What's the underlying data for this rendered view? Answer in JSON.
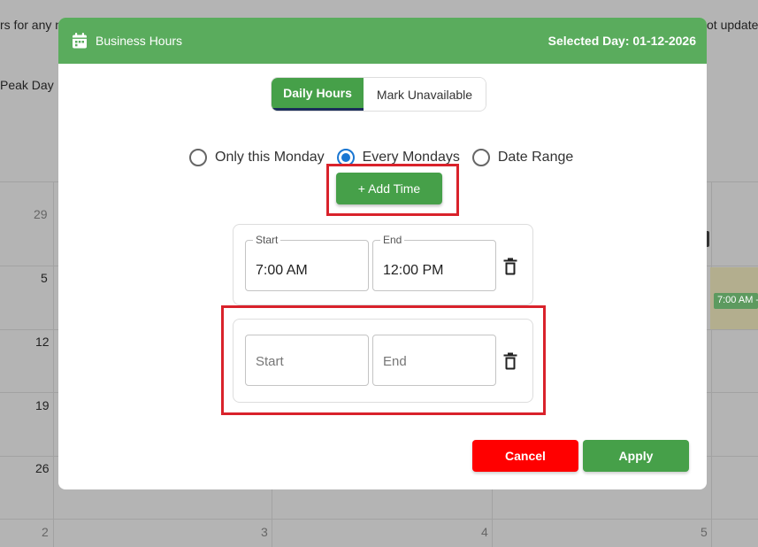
{
  "background": {
    "top_left_text": "rs for any n",
    "top_right_text": "ot update",
    "peak_day_label": "Peak Day",
    "week_numbers": [
      "29",
      "5",
      "12",
      "19",
      "26",
      "2"
    ],
    "bottom_numbers": [
      "3",
      "4",
      "5"
    ],
    "event_label": "7:00 AM -"
  },
  "modal": {
    "title": "Business Hours",
    "title_icon": "calendar-icon",
    "selected_day": "Selected Day: 01-12-2026",
    "header_color": "#5aac5d"
  },
  "tabs": [
    {
      "label": "Daily Hours",
      "active": true
    },
    {
      "label": "Mark Unavailable",
      "active": false
    }
  ],
  "recurrence": {
    "options": [
      "Only this Monday",
      "Every Mondays",
      "Date Range"
    ],
    "selected": "Every Mondays"
  },
  "add_time_label": "+ Add Time",
  "slots": [
    {
      "start_label": "Start",
      "start_value": "7:00 AM",
      "end_label": "End",
      "end_value": "12:00 PM"
    },
    {
      "start_placeholder": "Start",
      "end_placeholder": "End"
    }
  ],
  "footer": {
    "cancel_label": "Cancel",
    "apply_label": "Apply",
    "cancel_color": "#ff0000",
    "apply_color": "#46a049"
  },
  "highlight_color": "#d9222b"
}
